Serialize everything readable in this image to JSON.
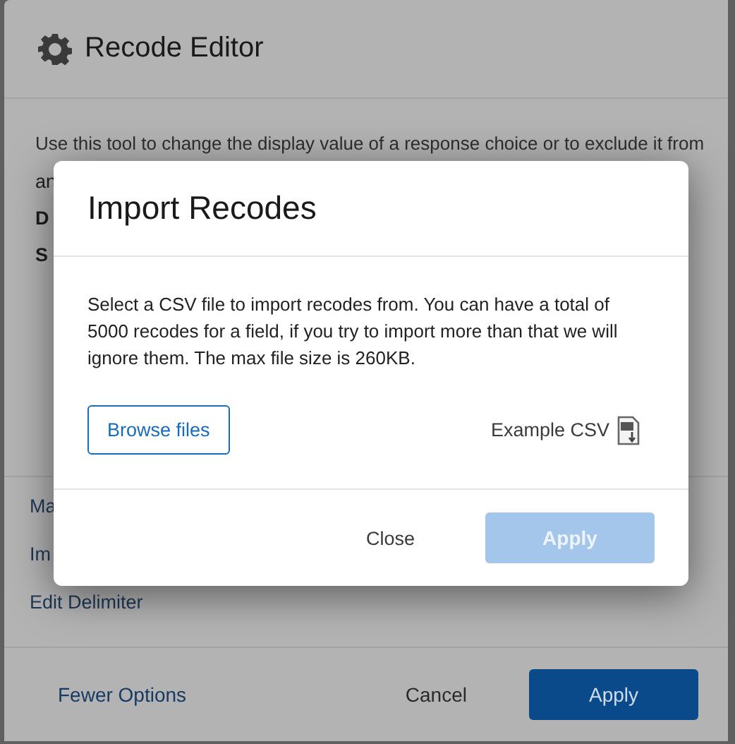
{
  "editor": {
    "title": "Recode Editor",
    "description": "Use this tool to change the display value of a response choice or to exclude it from",
    "visible_fragments": [
      "an",
      "D",
      "S"
    ],
    "options": [
      "Ma",
      "Im",
      "Edit Delimiter"
    ],
    "footer": {
      "toggle": "Fewer Options",
      "cancel": "Cancel",
      "apply": "Apply"
    }
  },
  "dialog": {
    "title": "Import Recodes",
    "message": "Select a CSV file to import recodes from. You can have a total of 5000 recodes for a field, if you try to import more than that we will ignore them. The max file size is 260KB.",
    "browse": "Browse files",
    "example": "Example CSV",
    "close": "Close",
    "apply": {
      "label": "Apply",
      "disabled": true
    }
  }
}
